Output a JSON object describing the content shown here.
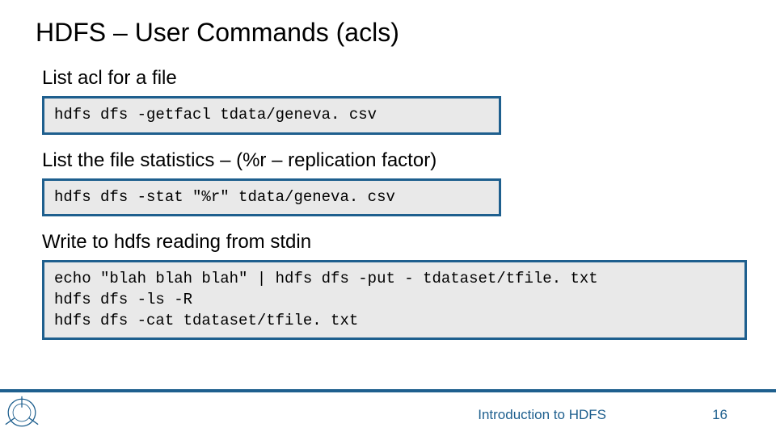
{
  "title": "HDFS – User Commands (acls)",
  "sections": [
    {
      "label": "List acl for a file",
      "code": "hdfs dfs -getfacl tdata/geneva. csv",
      "width": "narrow"
    },
    {
      "label": "List the file statistics – (%r – replication factor)",
      "code": "hdfs dfs -stat \"%r\" tdata/geneva. csv",
      "width": "narrow"
    },
    {
      "label": "Write to hdfs reading from stdin",
      "code": "echo \"blah blah blah\" | hdfs dfs -put - tdataset/tfile. txt\nhdfs dfs -ls -R\nhdfs dfs -cat tdataset/tfile. txt",
      "width": "wide"
    }
  ],
  "footer": {
    "text": "Introduction to HDFS",
    "page": "16"
  },
  "colors": {
    "accent": "#1e5f8e",
    "codebg": "#e9e9e9"
  }
}
